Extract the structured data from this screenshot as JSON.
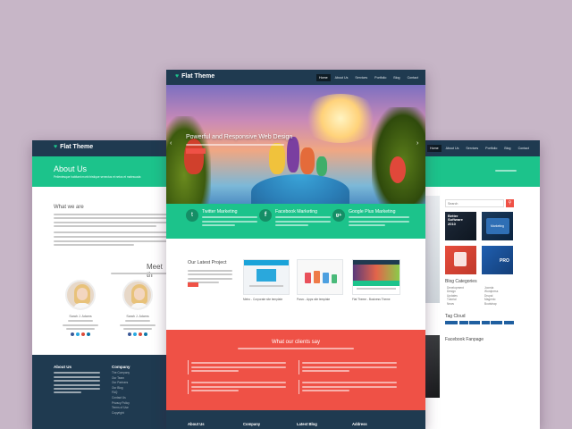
{
  "left": {
    "logo": "Flat Theme",
    "header_title": "About Us",
    "header_sub": "Pellentesque habitant morbi tristique senectus et netus et malesuada",
    "section_title": "What we are",
    "meet_title": "Meet th",
    "person1": {
      "name": "Sarah J. Adams"
    },
    "person2": {
      "name": "Sarah J. Adams"
    },
    "footer_about": "About Us",
    "footer_company": "Company",
    "company_links": [
      "The Company",
      "Our Team",
      "Our Partners",
      "Our Blog",
      "FAQ",
      "Contact Us",
      "Privacy Policy",
      "Terms of Use",
      "Copyright"
    ]
  },
  "center": {
    "logo": "Flat Theme",
    "nav": [
      "Home",
      "About Us",
      "Services",
      "Portfolio",
      "Blog",
      "Contact"
    ],
    "hero_title": "Powerful and Responsive Web Design",
    "features": [
      {
        "icon": "twitter-icon",
        "title": "Twitter Marketing"
      },
      {
        "icon": "facebook-icon",
        "title": "Facebook Marketing"
      },
      {
        "icon": "google-plus-icon",
        "title": "Google Plus Marketing"
      }
    ],
    "projects_title": "Our Latest Project",
    "projects": [
      {
        "caption": "Metro - Corporate site template"
      },
      {
        "caption": "Parzo - Apps site template"
      },
      {
        "caption": "Flat Theme - Business Theme"
      }
    ],
    "clients_title": "What our clients say",
    "footer": [
      "About Us",
      "Company",
      "Latest Blog",
      "Address"
    ]
  },
  "right": {
    "nav": [
      "Home",
      "About Us",
      "Services",
      "Portfolio",
      "Blog",
      "Contact"
    ],
    "search_placeholder": "Search",
    "ad1": "Better Software 2010",
    "ad2": "Marketing",
    "ad3": "PRO",
    "blog_categories_title": "Blog Categories",
    "categories_left": [
      "Development",
      "Design",
      "Updates",
      "Tutorial",
      "News"
    ],
    "categories_right": [
      "Joomla",
      "Wordpress",
      "Drupal",
      "Magento",
      "Bootstrap"
    ],
    "tag_cloud_title": "Tag Cloud",
    "facebook_title": "Facebook Fanpage"
  },
  "colors": {
    "background": "#c7b6c7",
    "navy": "#1f3a50",
    "green": "#1cc38b",
    "red": "#ef5146"
  }
}
